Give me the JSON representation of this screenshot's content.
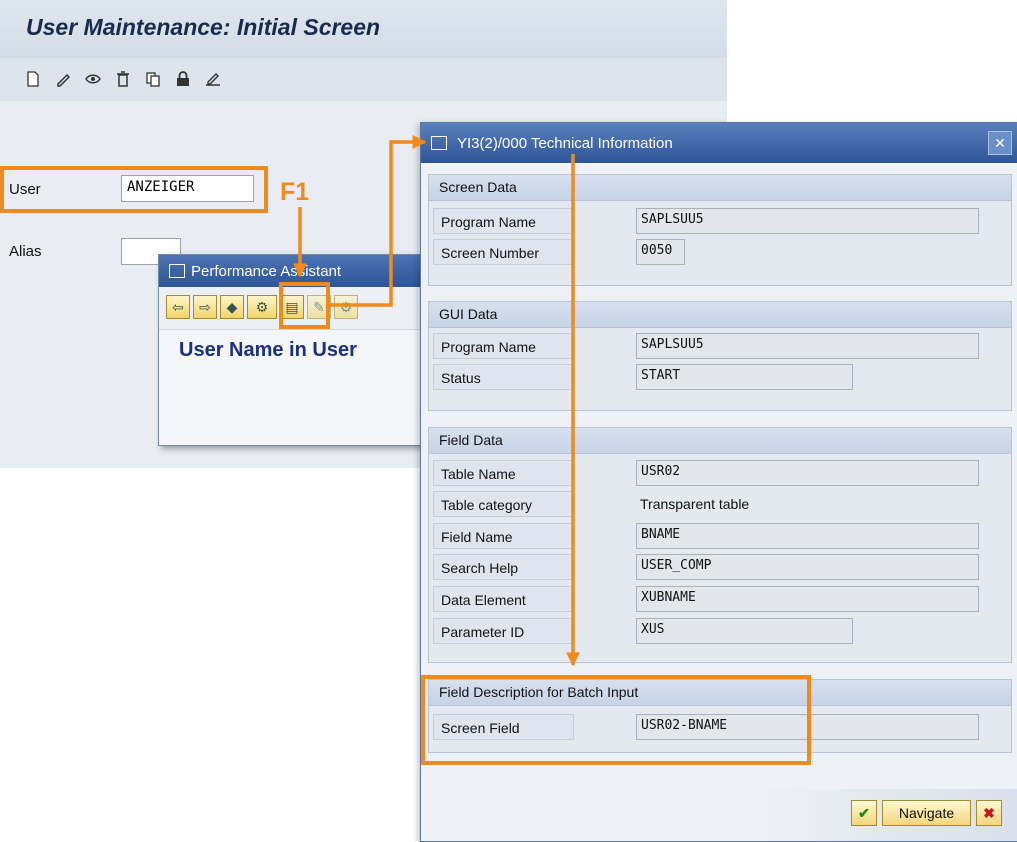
{
  "main": {
    "title": "User Maintenance: Initial Screen",
    "toolbar": [
      "create-icon",
      "change-icon",
      "display-icon",
      "delete-icon",
      "copy-icon",
      "lock-icon",
      "edit-icon"
    ],
    "user_label": "User",
    "user_value": "ANZEIGER",
    "alias_label": "Alias",
    "alias_value": ""
  },
  "annotation": {
    "f1_label": "F1",
    "color": "#f08a1c"
  },
  "perf": {
    "title": "Performance Assistant",
    "heading": "User Name in User",
    "toolbar": [
      "back-arrow-icon",
      "forward-arrow-icon",
      "book-icon",
      "technical-info-icon",
      "document-icon",
      "pencil-icon",
      "settings-icon"
    ]
  },
  "tech": {
    "title": "YI3(2)/000 Technical Information",
    "screen_data": {
      "head": "Screen Data",
      "program_name_label": "Program Name",
      "program_name": "SAPLSUU5",
      "screen_number_label": "Screen Number",
      "screen_number": "0050"
    },
    "gui_data": {
      "head": "GUI Data",
      "program_name_label": "Program Name",
      "program_name": "SAPLSUU5",
      "status_label": "Status",
      "status": "START"
    },
    "field_data": {
      "head": "Field Data",
      "table_name_label": "Table Name",
      "table_name": "USR02",
      "table_category_label": "Table category",
      "table_category": "Transparent table",
      "field_name_label": "Field Name",
      "field_name": "BNAME",
      "search_help_label": "Search Help",
      "search_help": "USER_COMP",
      "data_element_label": "Data Element",
      "data_element": "XUBNAME",
      "parameter_id_label": "Parameter ID",
      "parameter_id": "XUS"
    },
    "batch": {
      "head": "Field Description for Batch Input",
      "screen_field_label": "Screen Field",
      "screen_field": "USR02-BNAME"
    },
    "footer": {
      "navigate_label": "Navigate"
    }
  }
}
